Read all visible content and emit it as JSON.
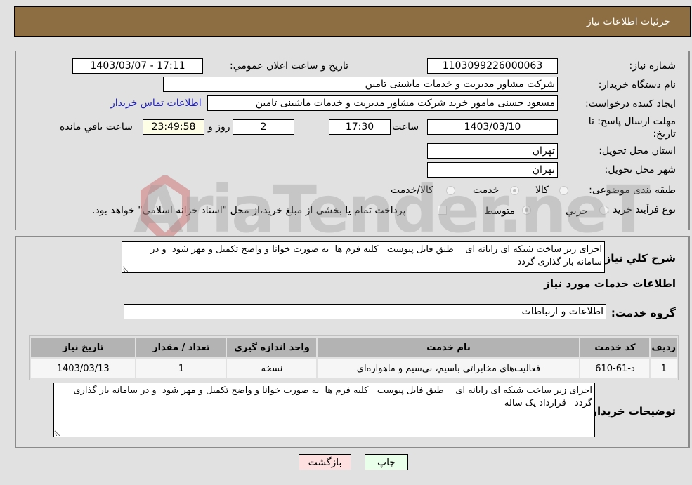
{
  "header": {
    "title": "جزئیات اطلاعات نیاز"
  },
  "form": {
    "need_number": {
      "label": "شماره نیاز:",
      "value": "1103099226000063"
    },
    "announce_datetime": {
      "label": "تاریخ و ساعت اعلان عمومي:",
      "value": "1403/03/07 - 17:11"
    },
    "buyer_org": {
      "label": "نام دستگاه خریدار:",
      "value": "شرکت مشاور مدیریت و خدمات ماشینی تامین"
    },
    "requester": {
      "label": "ایجاد کننده درخواست:",
      "value": "مسعود حسنی مامور خرید شرکت مشاور مدیریت و خدمات ماشینی تامین"
    },
    "buyer_contact_link": "اطلاعات تماس خریدار",
    "deadline": {
      "label": "مهلت ارسال پاسخ: تا تاریخ:",
      "date": "1403/03/10",
      "time_label": "ساعت",
      "time": "17:30",
      "days": "2",
      "days_label": "روز و",
      "remaining": "23:49:58",
      "remaining_label": "ساعت باقي مانده"
    },
    "province": {
      "label": "استان محل تحویل:",
      "value": "تهران"
    },
    "city": {
      "label": "شهر محل تحویل:",
      "value": "تهران"
    },
    "category": {
      "label": "طبقه بندی موضوعی:",
      "options": [
        "کالا",
        "خدمت",
        "کالا/خدمت"
      ],
      "selected": "خدمت"
    },
    "purchase_type": {
      "label": "نوع فرآیند خرید :",
      "options": [
        "جزیي",
        "متوسط"
      ],
      "selected": "متوسط",
      "treasury_note": "پرداخت تمام یا بخشی از مبلغ خرید،از محل \"اسناد خزانه اسلامی\" خواهد بود."
    }
  },
  "details": {
    "general_desc_label": "شرح کلي نیاز:",
    "general_desc": "اجرای زیر ساخت شبکه ای رایانه ای    طبق فایل پیوست   کلیه فرم ها  به صورت خوانا و واضح تکمیل و مهر شود  و در سامانه بار گذاری گردد",
    "services_title": "اطلاعات خدمات مورد نیاز",
    "service_group_label": "گروه خدمت:",
    "service_group": "اطلاعات و ارتباطات",
    "table": {
      "headers": [
        "ردیف",
        "کد خدمت",
        "نام خدمت",
        "واحد اندازه گیری",
        "تعداد / مقدار",
        "تاریخ نیاز"
      ],
      "rows": [
        [
          "1",
          "د-61-610",
          "فعالیت‌های مخابراتی باسیم، بی‌سیم و ماهواره‌ای",
          "نسخه",
          "1",
          "1403/03/13"
        ]
      ]
    },
    "buyer_notes_label": "توضیحات خریدار:",
    "buyer_notes": "اجرای زیر ساخت شبکه ای رایانه ای    طبق فایل پیوست   کلیه فرم ها  به صورت خوانا و واضح تکمیل و مهر شود  و در سامانه بار گذاری گردد   قرارداد یک ساله"
  },
  "buttons": {
    "print": "چاپ",
    "back": "بازگشت"
  },
  "watermark": "AriaTender.neT",
  "colors": {
    "header_bg": "#8d6e43",
    "print_bg": "#eaffea",
    "back_bg": "#ffe0e0",
    "link": "#2020c0"
  }
}
